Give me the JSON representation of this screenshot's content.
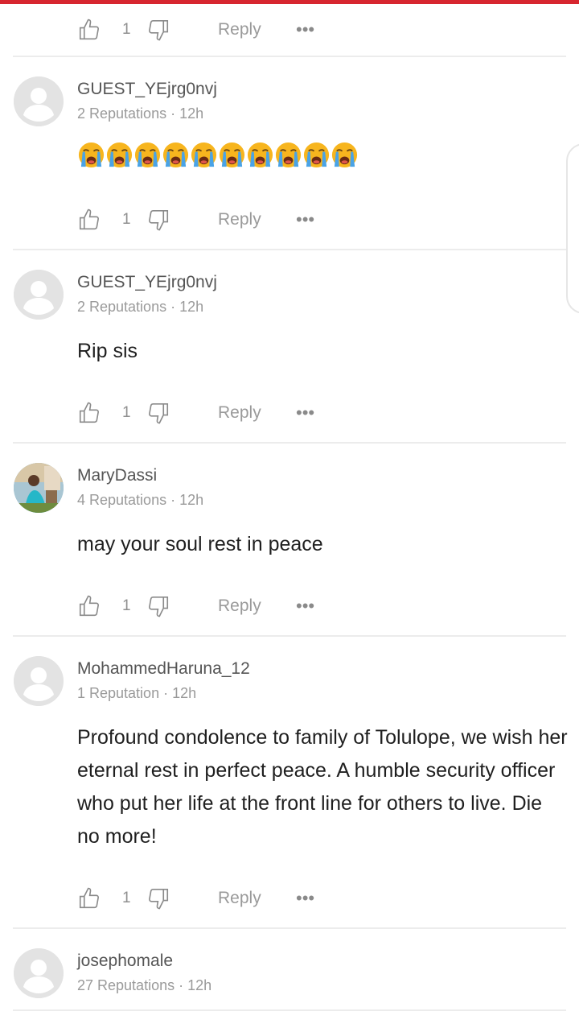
{
  "reply_label": "Reply",
  "more_label": "•••",
  "top_actions": {
    "like_count": "1"
  },
  "comments": [
    {
      "username": "GUEST_YEjrg0nvj",
      "meta": "2 Reputations · 12h",
      "avatar": "default-avatar",
      "body_type": "emoji",
      "emoji": "loudly-crying-face",
      "emoji_count": 10,
      "like_count": "1"
    },
    {
      "username": "GUEST_YEjrg0nvj",
      "meta": "2 Reputations · 12h",
      "avatar": "default-avatar",
      "body": "Rip sis",
      "like_count": "1"
    },
    {
      "username": "MaryDassi",
      "meta": "4 Reputations · 12h",
      "avatar": "photo-avatar",
      "body": "may your soul rest in peace",
      "like_count": "1"
    },
    {
      "username": "MohammedHaruna_12",
      "meta": "1 Reputation · 12h",
      "avatar": "default-avatar",
      "body": "Profound condolence to family of Tolulope, we wish her eternal rest in perfect peace.  A humble security officer who put her life at the front line for others to live. Die no more!",
      "like_count": "1"
    },
    {
      "username": "josephomale",
      "meta": "27 Reputations · 12h",
      "avatar": "default-avatar"
    }
  ],
  "colors": {
    "accent": "#d7262f",
    "divider": "#ececec",
    "meta": "#9a9a9a"
  }
}
